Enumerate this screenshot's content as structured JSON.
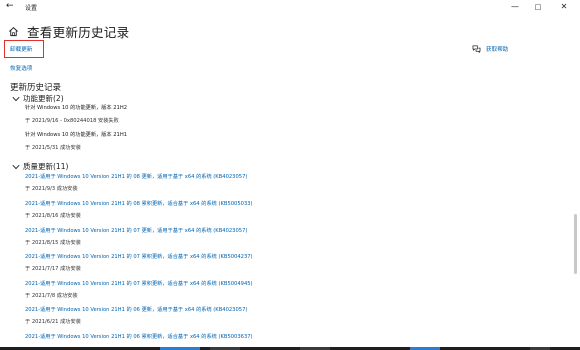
{
  "window": {
    "title": "设置",
    "back_glyph": "←",
    "min_glyph": "—",
    "max_glyph": "□",
    "close_glyph": "✕"
  },
  "header": {
    "title": "查看更新历史记录"
  },
  "links": {
    "uninstall": "卸载更新",
    "recovery": "恢复选项",
    "help": "获取帮助"
  },
  "section_title": "更新历史记录",
  "feature_group": {
    "label": "功能更新(2)",
    "items": [
      {
        "title": "针对 Windows 10 的功能更新，版本 21H2",
        "status": "于 2021/9/16 - 0x80244018 安装失败"
      },
      {
        "title": "针对 Windows 10 的功能更新，版本 21H1",
        "status": "于 2021/5/31 成功安装"
      }
    ]
  },
  "quality_group": {
    "label": "质量更新(11)",
    "items": [
      {
        "title": "2021-适用于 Windows 10 Version 21H1 的 08 更新，适用于基于 x64 的系统 (KB4023057)",
        "status": "于 2021/9/3 成功安装"
      },
      {
        "title": "2021-适用于 Windows 10 Version 21H1 的 08 累积更新，适合基于 x64 的系统 (KB5005033)",
        "status": "于 2021/8/16 成功安装"
      },
      {
        "title": "2021-适用于 Windows 10 Version 21H1 的 07 更新，适用于基于 x64 的系统 (KB4023057)",
        "status": "于 2021/8/15 成功安装"
      },
      {
        "title": "2021-适用于 Windows 10 Version 21H1 的 07 累积更新，适合基于 x64 的系统 (KB5004237)",
        "status": "于 2021/7/17 成功安装"
      },
      {
        "title": "2021-适用于 Windows 10 Version 21H1 的 07 累积更新，适合基于 x64 的系统 (KB5004945)",
        "status": "于 2021/7/8 成功安装"
      },
      {
        "title": "2021-适用于 Windows 10 Version 21H1 的 06 更新，适用于基于 x64 的系统 (KB4023057)",
        "status": "于 2021/6/21 成功安装"
      },
      {
        "title": "2021-适用于 Windows 10 Version 21H1 的 06 累积更新，适合基于 x64 的系统 (KB5003637)",
        "status": ""
      }
    ]
  },
  "colors": {
    "link": "#0063b1",
    "highlight_box": "#e0312c"
  }
}
